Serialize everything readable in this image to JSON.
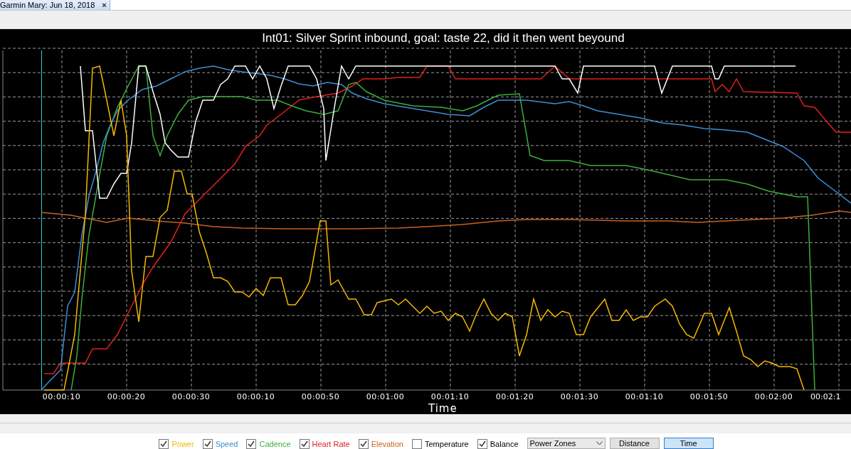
{
  "tab": {
    "title": "Garmin Mary: Jun 18, 2018",
    "close": "×"
  },
  "chart": {
    "title": "Int01: Silver Sprint inbound, goal: taste 22, did it then went beyound",
    "x_ticks": [
      "00:00:10",
      "00:00:20",
      "00:00:30",
      "00:00:10",
      "00:00:50",
      "00:01:00",
      "00:01:10",
      "00:01:20",
      "00:01:30",
      "00:01:10",
      "00:01:50",
      "00:02:00",
      "00:02:1"
    ],
    "x_label": "Time"
  },
  "legend": [
    {
      "label": "Power",
      "color": "#f5b800",
      "checked": true
    },
    {
      "label": "Speed",
      "color": "#3d8fd6",
      "checked": true
    },
    {
      "label": "Cadence",
      "color": "#3cae3c",
      "checked": true
    },
    {
      "label": "Heart Rate",
      "color": "#e0201c",
      "checked": true
    },
    {
      "label": "Elevation",
      "color": "#c8621e",
      "checked": true
    },
    {
      "label": "Temperature",
      "color": "#000000",
      "checked": false
    },
    {
      "label": "Balance",
      "color": "#000000",
      "checked": true
    }
  ],
  "zone_select": {
    "value": "Power Zones"
  },
  "axis_buttons": [
    {
      "label": "Distance",
      "selected": false
    },
    {
      "label": "Time",
      "selected": true
    }
  ]
}
